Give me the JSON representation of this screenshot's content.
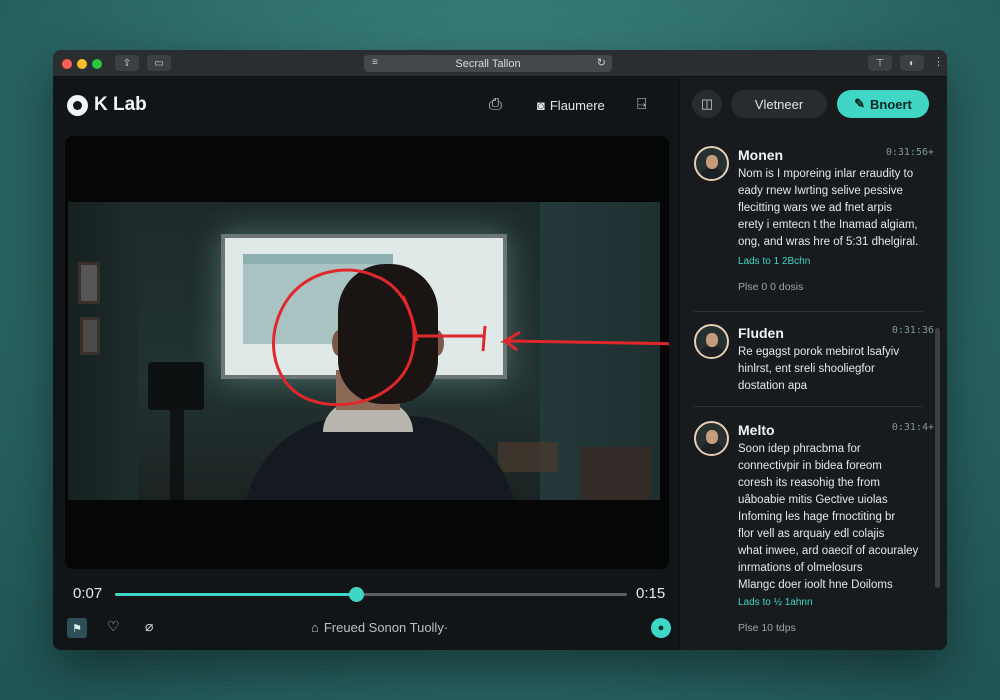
{
  "window": {
    "url_title": "Secrall Tallon"
  },
  "header": {
    "brand": "K Lab",
    "nav_label": "Flaumere"
  },
  "player": {
    "current_time": "0:07",
    "duration": "0:15",
    "progress": 0.47,
    "bottom_label": "Freued Sonon Tuolly·"
  },
  "sidebar": {
    "view_label": "Vletneer",
    "action_label": "Bnoert",
    "accent": "#3fd6c5",
    "comments": [
      {
        "name": "Monen",
        "time": "0:31:56+",
        "lines": [
          "Nom is I mporeing inlar eraudity to",
          "eady rnew Iwrting selive pessive",
          "flecitting wars we ad fnet arpis",
          "erety i emtecn t the Inamad algiam,",
          "ong, and wras hre of 5:31 dhelgiral."
        ],
        "link": "Lads to 1  2Bchn",
        "meta": "Plse 0 0  dosis"
      },
      {
        "name": "Fluden",
        "time": "0:31:36",
        "lines": [
          "Re egagst porok mebirot lsafyiv",
          "hinlrst, ent sreli shooliegfor",
          "dostation apa"
        ]
      },
      {
        "name": "Melto",
        "time": "0:31:4+",
        "lines": [
          "Soon idep phracbma for",
          "connectivpir in bidea foreom",
          "coresh its reasohig the from",
          "uâboabie mitis Gective uiolas",
          "Infoming les hage frnoctiting br",
          "flor vell as arquaiy edl colajis",
          "what inwee, ard oaecif of acouraley",
          "inrmations of olmelosurs",
          "Mlangc doer ioolt hne Doiloms"
        ],
        "link": "Lads to  ½ 1ahnn",
        "meta": "Plse 10  tdps"
      }
    ]
  }
}
